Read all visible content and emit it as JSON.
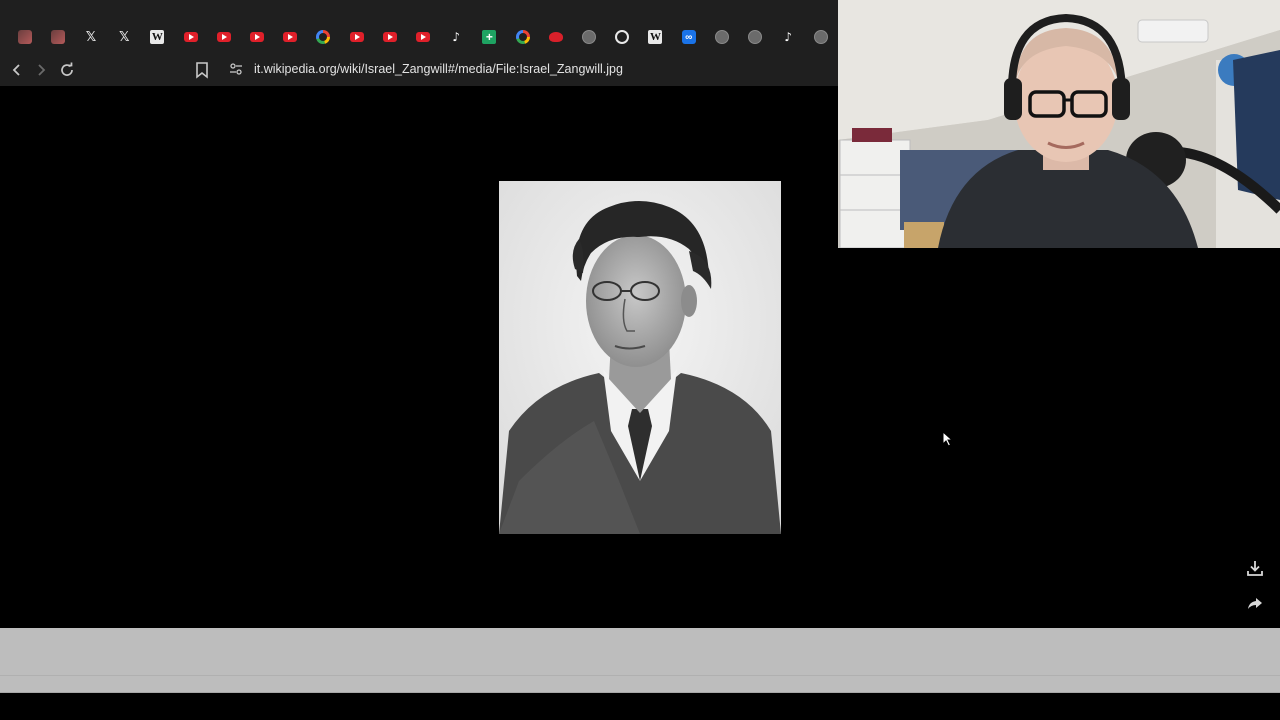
{
  "browser": {
    "tabs": [
      {
        "icon": "avatar-icon"
      },
      {
        "icon": "avatar-icon"
      },
      {
        "icon": "x-icon",
        "glyph": "𝕏"
      },
      {
        "icon": "x-icon",
        "glyph": "𝕏"
      },
      {
        "icon": "wikipedia-icon",
        "glyph": "W"
      },
      {
        "icon": "youtube-icon"
      },
      {
        "icon": "youtube-icon"
      },
      {
        "icon": "youtube-icon"
      },
      {
        "icon": "youtube-icon"
      },
      {
        "icon": "google-icon"
      },
      {
        "icon": "youtube-icon"
      },
      {
        "icon": "youtube-icon"
      },
      {
        "icon": "youtube-icon"
      },
      {
        "icon": "tiktok-icon",
        "glyph": "♪"
      },
      {
        "icon": "sheets-icon",
        "glyph": "+"
      },
      {
        "icon": "google-icon"
      },
      {
        "icon": "red-logo-icon"
      },
      {
        "icon": "globe-icon"
      },
      {
        "icon": "ring-icon"
      },
      {
        "icon": "wikipedia-icon",
        "glyph": "W"
      },
      {
        "icon": "infinity-icon",
        "glyph": "∞"
      },
      {
        "icon": "globe-icon"
      },
      {
        "icon": "globe-icon"
      },
      {
        "icon": "tiktok-icon",
        "glyph": "♪"
      },
      {
        "icon": "globe-icon"
      }
    ],
    "nav": {
      "back_glyph": "‹",
      "forward_glyph": "›",
      "reload_glyph": "↻"
    },
    "url": "it.wikipedia.org/wiki/Israel_Zangwill#/media/File:Israel_Zangwill.jpg"
  },
  "viewer": {
    "image_icon": "portrait-photo",
    "actions": [
      {
        "icon": "download-icon"
      },
      {
        "icon": "share-icon"
      }
    ]
  },
  "overlay": {
    "icon": "webcam-feed"
  },
  "colors": {
    "toolbar": "#1f1f1f",
    "url_text": "#e3e3e3",
    "youtube_red": "#e0202a",
    "bottom_strip": "#bdbdbd"
  }
}
